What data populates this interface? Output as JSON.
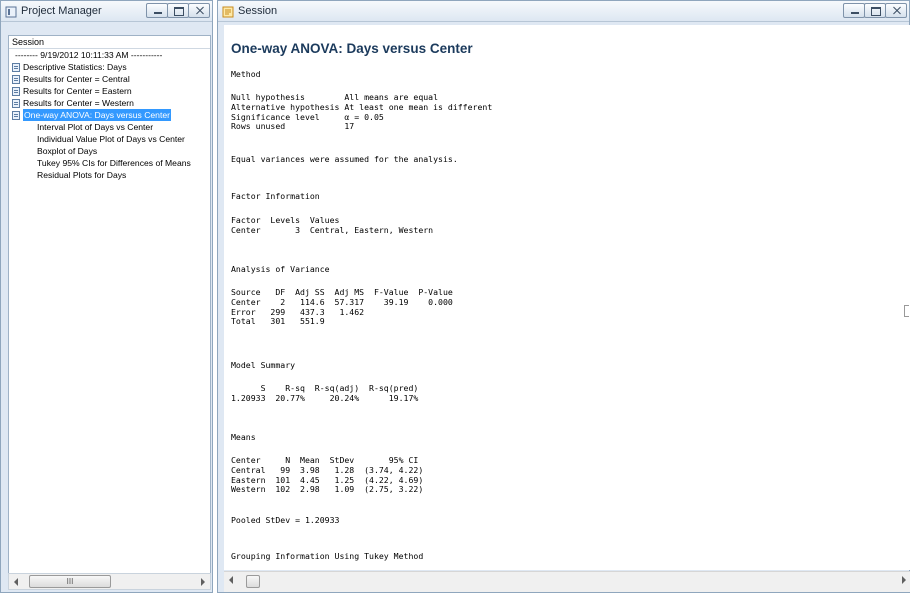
{
  "project_manager": {
    "title": "Project Manager",
    "tab_label": "Session",
    "items": [
      {
        "label": "-------- 9/19/2012 10:11:33 AM -----------",
        "kind": "sep"
      },
      {
        "label": "Descriptive Statistics: Days",
        "kind": "doc"
      },
      {
        "label": "Results for Center = Central",
        "kind": "doc"
      },
      {
        "label": "Results for Center = Eastern",
        "kind": "doc"
      },
      {
        "label": "Results for Center = Western",
        "kind": "doc"
      },
      {
        "label": "One-way ANOVA: Days versus Center",
        "kind": "doc",
        "selected": true
      },
      {
        "label": "Interval Plot of Days vs Center",
        "kind": "sub"
      },
      {
        "label": "Individual Value Plot of Days vs Center",
        "kind": "sub"
      },
      {
        "label": "Boxplot of Days",
        "kind": "sub"
      },
      {
        "label": "Tukey 95% CIs for Differences of Means",
        "kind": "sub"
      },
      {
        "label": "Residual Plots for Days",
        "kind": "sub"
      }
    ],
    "scroll_thumb_label": "III"
  },
  "session": {
    "title": "Session",
    "heading": "One-way ANOVA: Days versus Center",
    "method_title": "Method",
    "method_body": "Null hypothesis        All means are equal\nAlternative hypothesis At least one mean is different\nSignificance level     α = 0.05\nRows unused            17",
    "equal_var_note": "Equal variances were assumed for the analysis.",
    "factor_title": "Factor Information",
    "factor_body": "Factor  Levels  Values\nCenter       3  Central, Eastern, Western",
    "anova_title": "Analysis of Variance",
    "anova_body": "Source   DF  Adj SS  Adj MS  F-Value  P-Value\nCenter    2   114.6  57.317    39.19    0.000\nError   299   437.3   1.462\nTotal   301   551.9",
    "summary_title": "Model Summary",
    "summary_body": "      S    R-sq  R-sq(adj)  R-sq(pred)\n1.20933  20.77%     20.24%      19.17%",
    "means_title": "Means",
    "means_body": "Center     N  Mean  StDev       95% CI\nCentral   99  3.98   1.28  (3.74, 4.22)\nEastern  101  4.45   1.25  (4.22, 4.69)\nWestern  102  2.98   1.09  (2.75, 3.22)",
    "pooled": "Pooled StDev = 1.20933",
    "grouping_title": "Grouping Information Using Tukey Method"
  },
  "icons": {
    "project_manager": "project-manager-icon",
    "session": "session-icon",
    "doc": "document-icon"
  }
}
